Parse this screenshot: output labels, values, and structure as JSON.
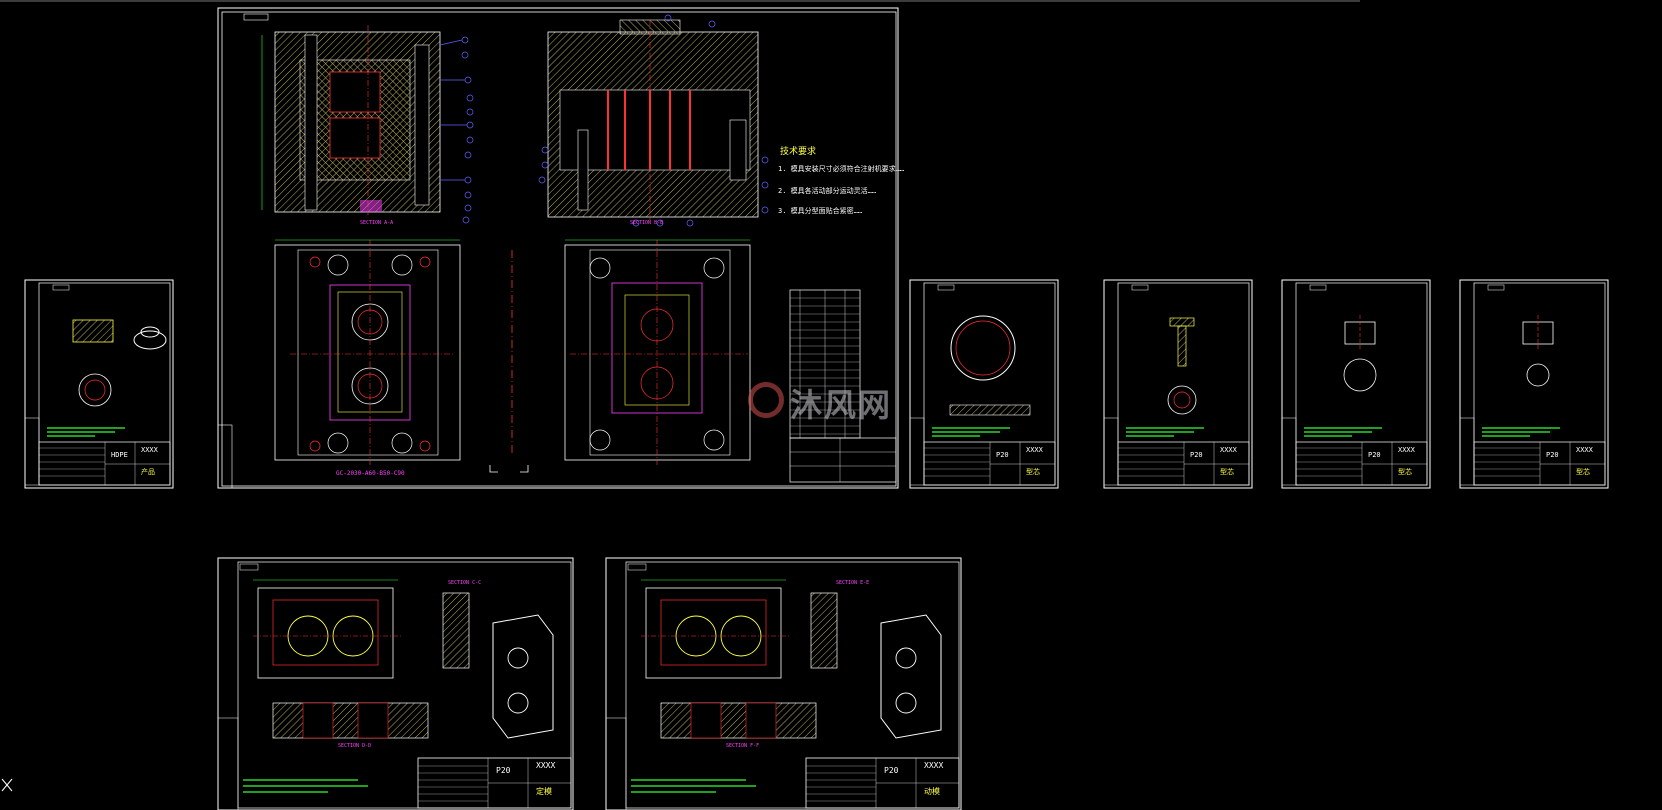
{
  "watermark": "沐风网",
  "main_sheet": {
    "tech_title": "技术要求",
    "tech_lines": [
      "1. 模具安装尺寸必须符合注射机要求……",
      "2. 模具各活动部分运动灵活……",
      "3. 模具分型面贴合紧密……"
    ],
    "section_labels": [
      "SECTION A-A",
      "SECTION B-B"
    ],
    "base_label": "GC-2030-A60-B50-C90"
  },
  "small_sheets": [
    {
      "material": "HDPE",
      "code": "XXXX",
      "name": "产品"
    },
    {
      "material": "P20",
      "code": "XXXX",
      "name": "型芯"
    },
    {
      "material": "P20",
      "code": "XXXX",
      "name": "型芯"
    },
    {
      "material": "P20",
      "code": "XXXX",
      "name": "型芯"
    },
    {
      "material": "P20",
      "code": "XXXX",
      "name": "型芯"
    }
  ],
  "bottom_sheets": [
    {
      "material": "P20",
      "code": "XXXX",
      "name": "定模",
      "sections": [
        "SECTION C-C",
        "SECTION D-D"
      ]
    },
    {
      "material": "P20",
      "code": "XXXX",
      "name": "动模",
      "sections": [
        "SECTION E-E",
        "SECTION F-F"
      ]
    }
  ],
  "colors": {
    "background": "#000000",
    "frame": "#ffffff",
    "hatch": "#c8c850",
    "centerline": "#ff3030",
    "dimension": "#33ff33",
    "balloon": "#6060ff",
    "label": "#ff40ff"
  },
  "cursor_icon": "crosshair-icon"
}
